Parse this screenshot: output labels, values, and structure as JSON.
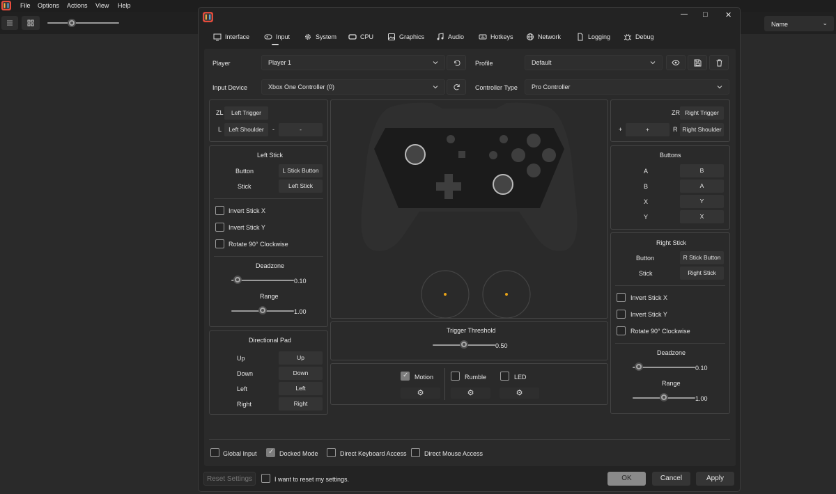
{
  "menu": {
    "items": [
      "File",
      "Options",
      "Actions",
      "View",
      "Help"
    ]
  },
  "toolbar": {
    "column_header": "Name",
    "column_chevron": "⌄"
  },
  "window": {
    "minimize": "—",
    "maximize": "□",
    "close": "✕"
  },
  "tabs": [
    {
      "label": "Interface",
      "icon": "monitor-icon"
    },
    {
      "label": "Input",
      "icon": "gamepad-icon",
      "active": true
    },
    {
      "label": "System",
      "icon": "gear-icon"
    },
    {
      "label": "CPU",
      "icon": "cpu-icon"
    },
    {
      "label": "Graphics",
      "icon": "image-icon"
    },
    {
      "label": "Audio",
      "icon": "music-icon"
    },
    {
      "label": "Hotkeys",
      "icon": "keyboard-icon"
    },
    {
      "label": "Network",
      "icon": "globe-icon"
    },
    {
      "label": "Logging",
      "icon": "document-icon"
    },
    {
      "label": "Debug",
      "icon": "bug-icon"
    }
  ],
  "top": {
    "player_label": "Player",
    "player_value": "Player 1",
    "profile_label": "Profile",
    "profile_value": "Default",
    "input_device_label": "Input Device",
    "input_device_value": "Xbox One Controller (0)",
    "controller_type_label": "Controller Type",
    "controller_type_value": "Pro Controller"
  },
  "left_triggers": {
    "zl_label": "ZL",
    "zl_value": "Left Trigger",
    "l_label": "L",
    "l_value": "Left Shoulder",
    "minus_label": "-",
    "minus_value": "-"
  },
  "right_triggers": {
    "zr_label": "ZR",
    "zr_value": "Right Trigger",
    "plus_label": "+",
    "plus_value": "+",
    "r_label": "R",
    "r_value": "Right Shoulder"
  },
  "left_stick": {
    "title": "Left Stick",
    "button_label": "Button",
    "button_value": "L Stick Button",
    "stick_label": "Stick",
    "stick_value": "Left Stick",
    "invert_x": "Invert Stick X",
    "invert_y": "Invert Stick Y",
    "rotate": "Rotate 90° Clockwise",
    "deadzone_label": "Deadzone",
    "deadzone_value": "0.10",
    "deadzone": 0.1,
    "range_label": "Range",
    "range_value": "1.00",
    "range": 1.0
  },
  "right_stick": {
    "title": "Right Stick",
    "button_label": "Button",
    "button_value": "R Stick Button",
    "stick_label": "Stick",
    "stick_value": "Right Stick",
    "invert_x": "Invert Stick X",
    "invert_y": "Invert Stick Y",
    "rotate": "Rotate 90° Clockwise",
    "deadzone_label": "Deadzone",
    "deadzone_value": "0.10",
    "deadzone": 0.1,
    "range_label": "Range",
    "range_value": "1.00",
    "range": 1.0
  },
  "buttons": {
    "title": "Buttons",
    "rows": [
      {
        "label": "A",
        "value": "B"
      },
      {
        "label": "B",
        "value": "A"
      },
      {
        "label": "X",
        "value": "Y"
      },
      {
        "label": "Y",
        "value": "X"
      }
    ]
  },
  "dpad": {
    "title": "Directional Pad",
    "rows": [
      {
        "label": "Up",
        "value": "Up"
      },
      {
        "label": "Down",
        "value": "Down"
      },
      {
        "label": "Left",
        "value": "Left"
      },
      {
        "label": "Right",
        "value": "Right"
      }
    ]
  },
  "trigger": {
    "label": "Trigger Threshold",
    "value": "0.50",
    "level": 0.5
  },
  "features": {
    "motion": "Motion",
    "motion_checked": true,
    "rumble": "Rumble",
    "led": "LED",
    "settings_glyph": "⚙"
  },
  "global": {
    "global_input": "Global Input",
    "docked_mode": "Docked Mode",
    "docked_checked": true,
    "direct_keyboard": "Direct Keyboard Access",
    "direct_mouse": "Direct Mouse Access"
  },
  "footer": {
    "reset": "Reset Settings",
    "reset_confirm": "I want to reset my settings.",
    "ok": "OK",
    "cancel": "Cancel",
    "apply": "Apply"
  },
  "colors": {
    "accent": "#e8a317",
    "panel_border": "#444444",
    "controller_body": "#2f2f2f",
    "controller_face": "#1b1b1b"
  }
}
